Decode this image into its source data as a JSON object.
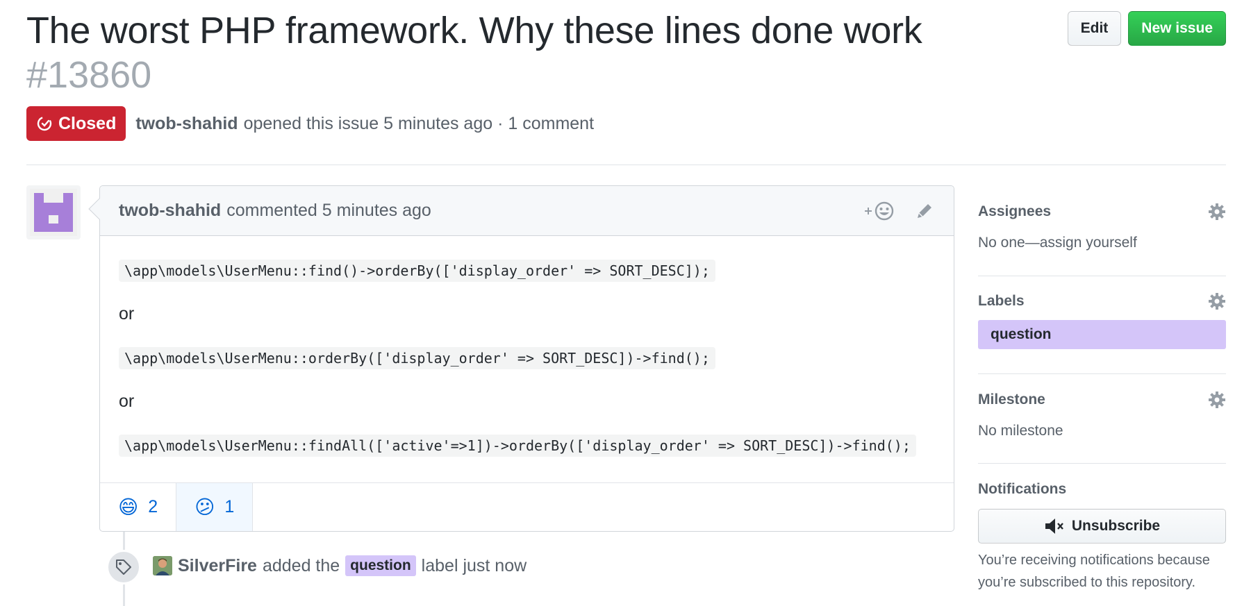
{
  "issue": {
    "title": "The worst PHP framework. Why these lines done work",
    "number": "#13860",
    "state": "Closed",
    "author": "twob-shahid",
    "opened_text": "opened this issue 5 minutes ago · 1 comment"
  },
  "header": {
    "edit_label": "Edit",
    "new_issue_label": "New issue"
  },
  "comment": {
    "author": "twob-shahid",
    "meta": "commented 5 minutes ago",
    "code1": "\\app\\models\\UserMenu::find()->orderBy(['display_order' => SORT_DESC]);",
    "or1": "or",
    "code2": "\\app\\models\\UserMenu::orderBy(['display_order' => SORT_DESC])->find();",
    "or2": "or",
    "code3": "\\app\\models\\UserMenu::findAll(['active'=>1])->orderBy(['display_order' => SORT_DESC])->find();",
    "reactions": [
      {
        "emoji": "😄",
        "count": "2",
        "icon": "smile-reaction-icon"
      },
      {
        "emoji": "😕",
        "count": "1",
        "icon": "confused-reaction-icon"
      }
    ]
  },
  "event": {
    "user": "SilverFire",
    "action": "added the",
    "label": "question",
    "suffix": "label just now"
  },
  "sidebar": {
    "assignees_title": "Assignees",
    "assignees_value": "No one—assign yourself",
    "labels_title": "Labels",
    "label": "question",
    "milestone_title": "Milestone",
    "milestone_value": "No milestone",
    "notifications_title": "Notifications",
    "unsubscribe_label": "Unsubscribe",
    "notifications_note": "You’re receiving notifications because you’re subscribed to this repository."
  },
  "colors": {
    "closed": "#cb2431",
    "new_issue": "#28a745",
    "label_question": "#d4c5f9",
    "link": "#0366d6"
  }
}
